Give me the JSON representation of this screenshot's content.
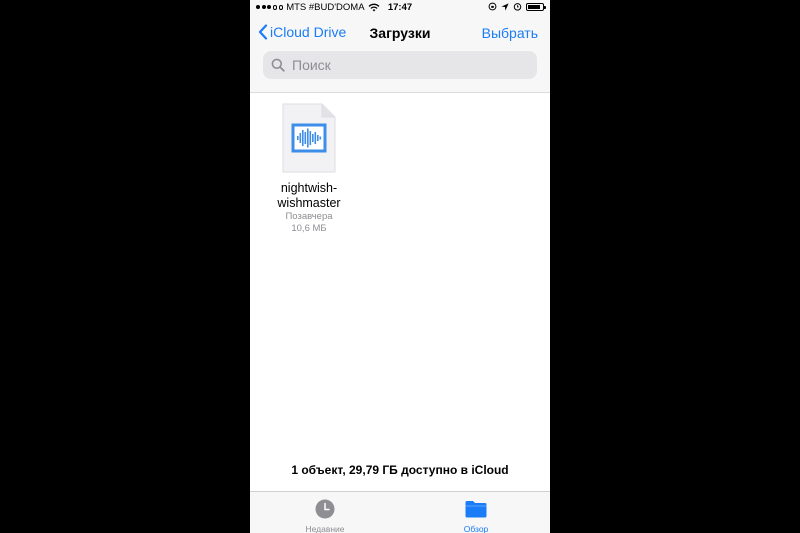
{
  "status_bar": {
    "carrier": "MTS #BUD'DOMA",
    "time": "17:47",
    "battery_level": 0.85,
    "icons": [
      "signal-dots-icon",
      "wifi-icon",
      "orientation-lock-icon",
      "location-arrow-icon",
      "alarm-icon",
      "battery-icon"
    ]
  },
  "nav": {
    "back_label": "iCloud Drive",
    "title": "Загрузки",
    "select_label": "Выбрать"
  },
  "search": {
    "placeholder": "Поиск"
  },
  "files": [
    {
      "name_line1": "nightwish-",
      "name_line2": "wishmaster",
      "date": "Позавчера",
      "size": "10,6 МБ",
      "icon": "audio-waveform-icon"
    }
  ],
  "footer": {
    "info": "1 объект, 29,79 ГБ доступно в iCloud"
  },
  "tabs": {
    "recent": "Недавние",
    "browse": "Обзор"
  },
  "colors": {
    "accent": "#1a7cf6",
    "background": "#000000",
    "bar": "#f7f7f7",
    "waveform": "#3d8ee8"
  }
}
